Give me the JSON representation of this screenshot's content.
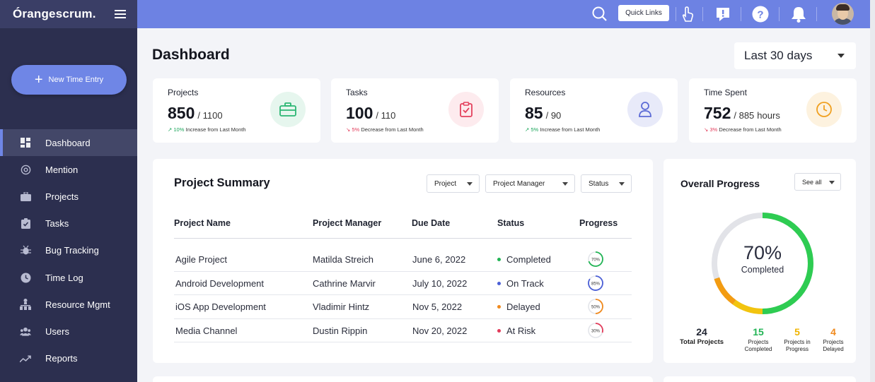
{
  "sidebar": {
    "brand": "Órangescrum.",
    "new_entry": "New Time Entry",
    "items": [
      {
        "label": "Dashboard",
        "icon": "dashboard-icon",
        "active": true
      },
      {
        "label": "Mention",
        "icon": "at-icon"
      },
      {
        "label": "Projects",
        "icon": "briefcase-icon"
      },
      {
        "label": "Tasks",
        "icon": "clipboard-icon"
      },
      {
        "label": "Bug Tracking",
        "icon": "bug-icon"
      },
      {
        "label": "Time Log",
        "icon": "clock-icon"
      },
      {
        "label": "Resource Mgmt",
        "icon": "hierarchy-icon"
      },
      {
        "label": "Users",
        "icon": "users-icon"
      },
      {
        "label": "Reports",
        "icon": "trend-icon"
      }
    ]
  },
  "topbar": {
    "quick_links": "Quick Links"
  },
  "header": {
    "title": "Dashboard",
    "range": "Last 30 days"
  },
  "stats": [
    {
      "label": "Projects",
      "value": "850",
      "total": "/ 1100",
      "unit": "",
      "trend_dir": "up",
      "trend_value": "10%",
      "trend_text": "Increase from Last Month",
      "icon": "briefcase-icon",
      "color": "#2bb673",
      "bg": "#e6f6ee"
    },
    {
      "label": "Tasks",
      "value": "100",
      "total": "/ 110",
      "unit": "",
      "trend_dir": "down",
      "trend_value": "5%",
      "trend_text": "Decrease from Last Month",
      "icon": "clipboard-check-icon",
      "color": "#e4415d",
      "bg": "#fdebee"
    },
    {
      "label": "Resources",
      "value": "85",
      "total": "/ 90",
      "unit": "",
      "trend_dir": "up",
      "trend_value": "5%",
      "trend_text": "Increase from Last Month",
      "icon": "person-icon",
      "color": "#5c6bd6",
      "bg": "#e8eaf9"
    },
    {
      "label": "Time Spent",
      "value": "752",
      "total": "/ 885",
      "unit": "hours",
      "trend_dir": "down",
      "trend_value": "3%",
      "trend_text": "Decrease from Last Month",
      "icon": "clock-icon",
      "color": "#f0a020",
      "bg": "#fdf2df"
    }
  ],
  "summary": {
    "title": "Project Summary",
    "filters": [
      "Project",
      "Project Manager",
      "Status"
    ],
    "columns": [
      "Project Name",
      "Project Manager",
      "Due Date",
      "Status",
      "Progress"
    ],
    "rows": [
      {
        "name": "Agile Project",
        "manager": "Matilda Streich",
        "due": "June 6, 2022",
        "status": "Completed",
        "status_color": "#22b455",
        "progress": 70,
        "progress_label": "70%",
        "ring_color": "#22b455"
      },
      {
        "name": "Android Development",
        "manager": "Cathrine Marvir",
        "due": "July 10, 2022",
        "status": "On Track",
        "status_color": "#4b5fd6",
        "progress": 85,
        "progress_label": "85%",
        "ring_color": "#4b5fd6"
      },
      {
        "name": "iOS App Development",
        "manager": "Vladimir Hintz",
        "due": "Nov 5, 2022",
        "status": "Delayed",
        "status_color": "#f08a1e",
        "progress": 50,
        "progress_label": "50%",
        "ring_color": "#f08a1e"
      },
      {
        "name": "Media Channel",
        "manager": "Dustin Rippin",
        "due": "Nov 20, 2022",
        "status": "At Risk",
        "status_color": "#e23b5a",
        "progress": 30,
        "progress_label": "30%",
        "ring_color": "#e23b5a"
      }
    ]
  },
  "overall": {
    "title": "Overall Progress",
    "see_all": "See all",
    "percent": "70%",
    "percent_value": 70,
    "percent_label": "Completed",
    "metrics": [
      {
        "value": "24",
        "label": "Total Projects",
        "color": "#1f2330"
      },
      {
        "value": "15",
        "label": "Projects Completed",
        "color": "#22b455"
      },
      {
        "value": "5",
        "label": "Projects in Progress",
        "color": "#f0b400"
      },
      {
        "value": "4",
        "label": "Projects Delayed",
        "color": "#f08a1e"
      }
    ]
  }
}
